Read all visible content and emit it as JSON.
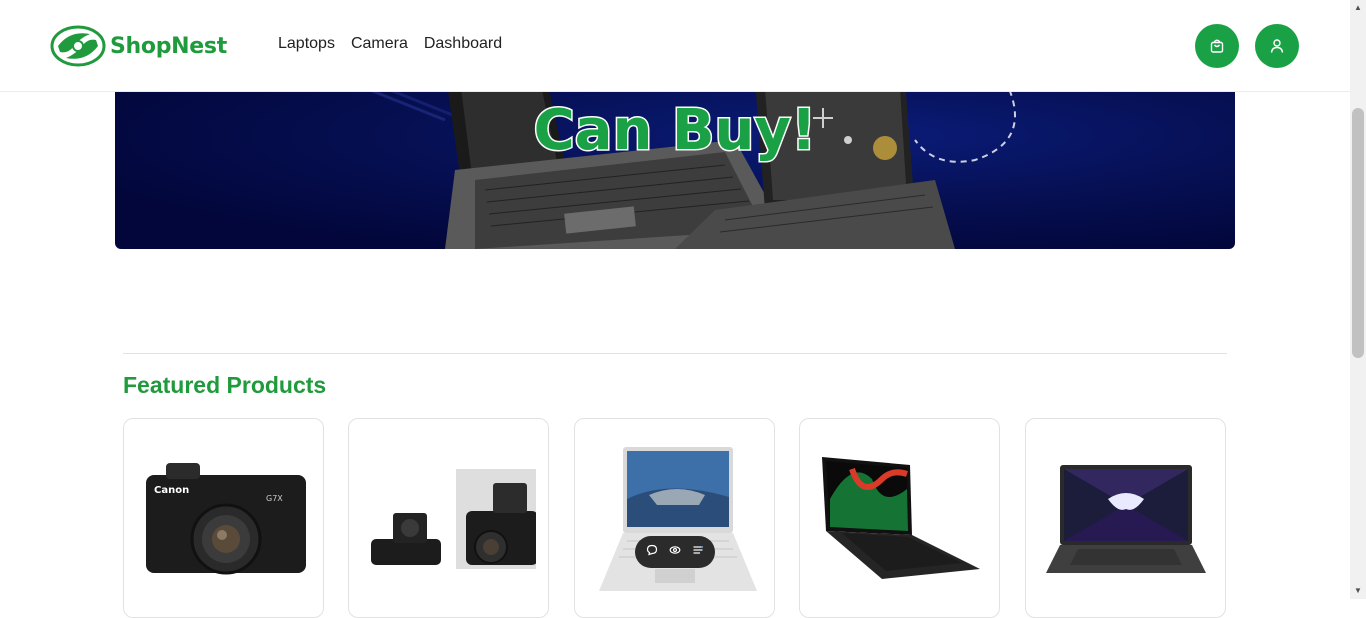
{
  "brand": {
    "name": "ShopNest",
    "color": "#1f9a3c"
  },
  "nav": {
    "items": [
      {
        "label": "Laptops"
      },
      {
        "label": "Camera"
      },
      {
        "label": "Dashboard"
      }
    ]
  },
  "header": {
    "cart_icon": "shopping-bag-icon",
    "user_icon": "user-icon"
  },
  "hero": {
    "headline": "Can Buy!"
  },
  "featured": {
    "title": "Featured Products",
    "products": [
      {
        "image": "canon-g7x-camera"
      },
      {
        "image": "compact-camera-pair"
      },
      {
        "image": "hp-laptop"
      },
      {
        "image": "razer-blade-laptop"
      },
      {
        "image": "rog-laptop"
      }
    ]
  },
  "floating_toolbar": {
    "icons": [
      "chat-bubble-icon",
      "eye-icon",
      "menu-list-icon"
    ]
  },
  "colors": {
    "accent": "#1aa146",
    "hero_bg": "#02063a"
  }
}
